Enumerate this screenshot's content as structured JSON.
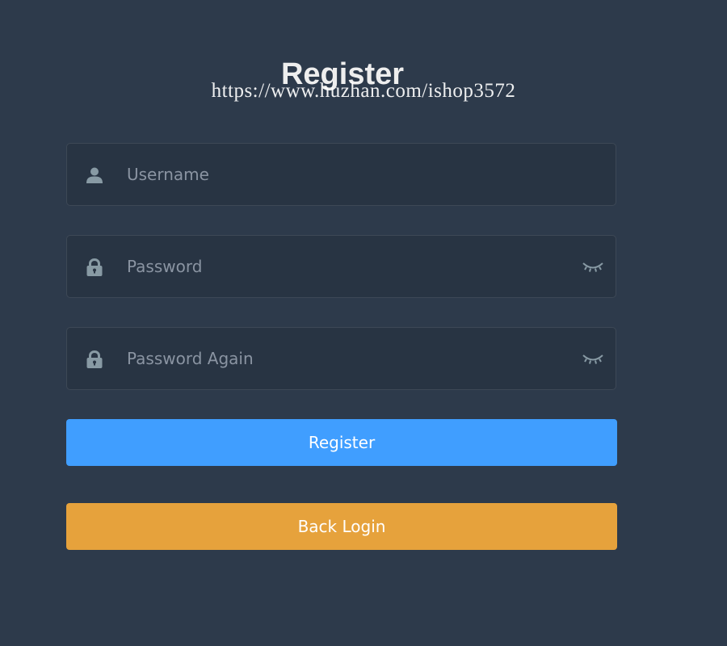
{
  "title": "Register",
  "watermark": "https://www.huzhan.com/ishop3572",
  "form": {
    "username": {
      "placeholder": "Username",
      "value": "",
      "icon": "user-icon"
    },
    "password": {
      "placeholder": "Password",
      "value": "",
      "icon": "lock-icon",
      "toggle_icon": "eye-closed-icon"
    },
    "password_again": {
      "placeholder": "Password Again",
      "value": "",
      "icon": "lock-icon",
      "toggle_icon": "eye-closed-icon"
    }
  },
  "buttons": {
    "register_label": "Register",
    "back_login_label": "Back Login"
  },
  "colors": {
    "background": "#2d3a4b",
    "field_background": "#283443",
    "primary": "#409eff",
    "warning": "#e6a23c",
    "icon": "#889aa4"
  }
}
